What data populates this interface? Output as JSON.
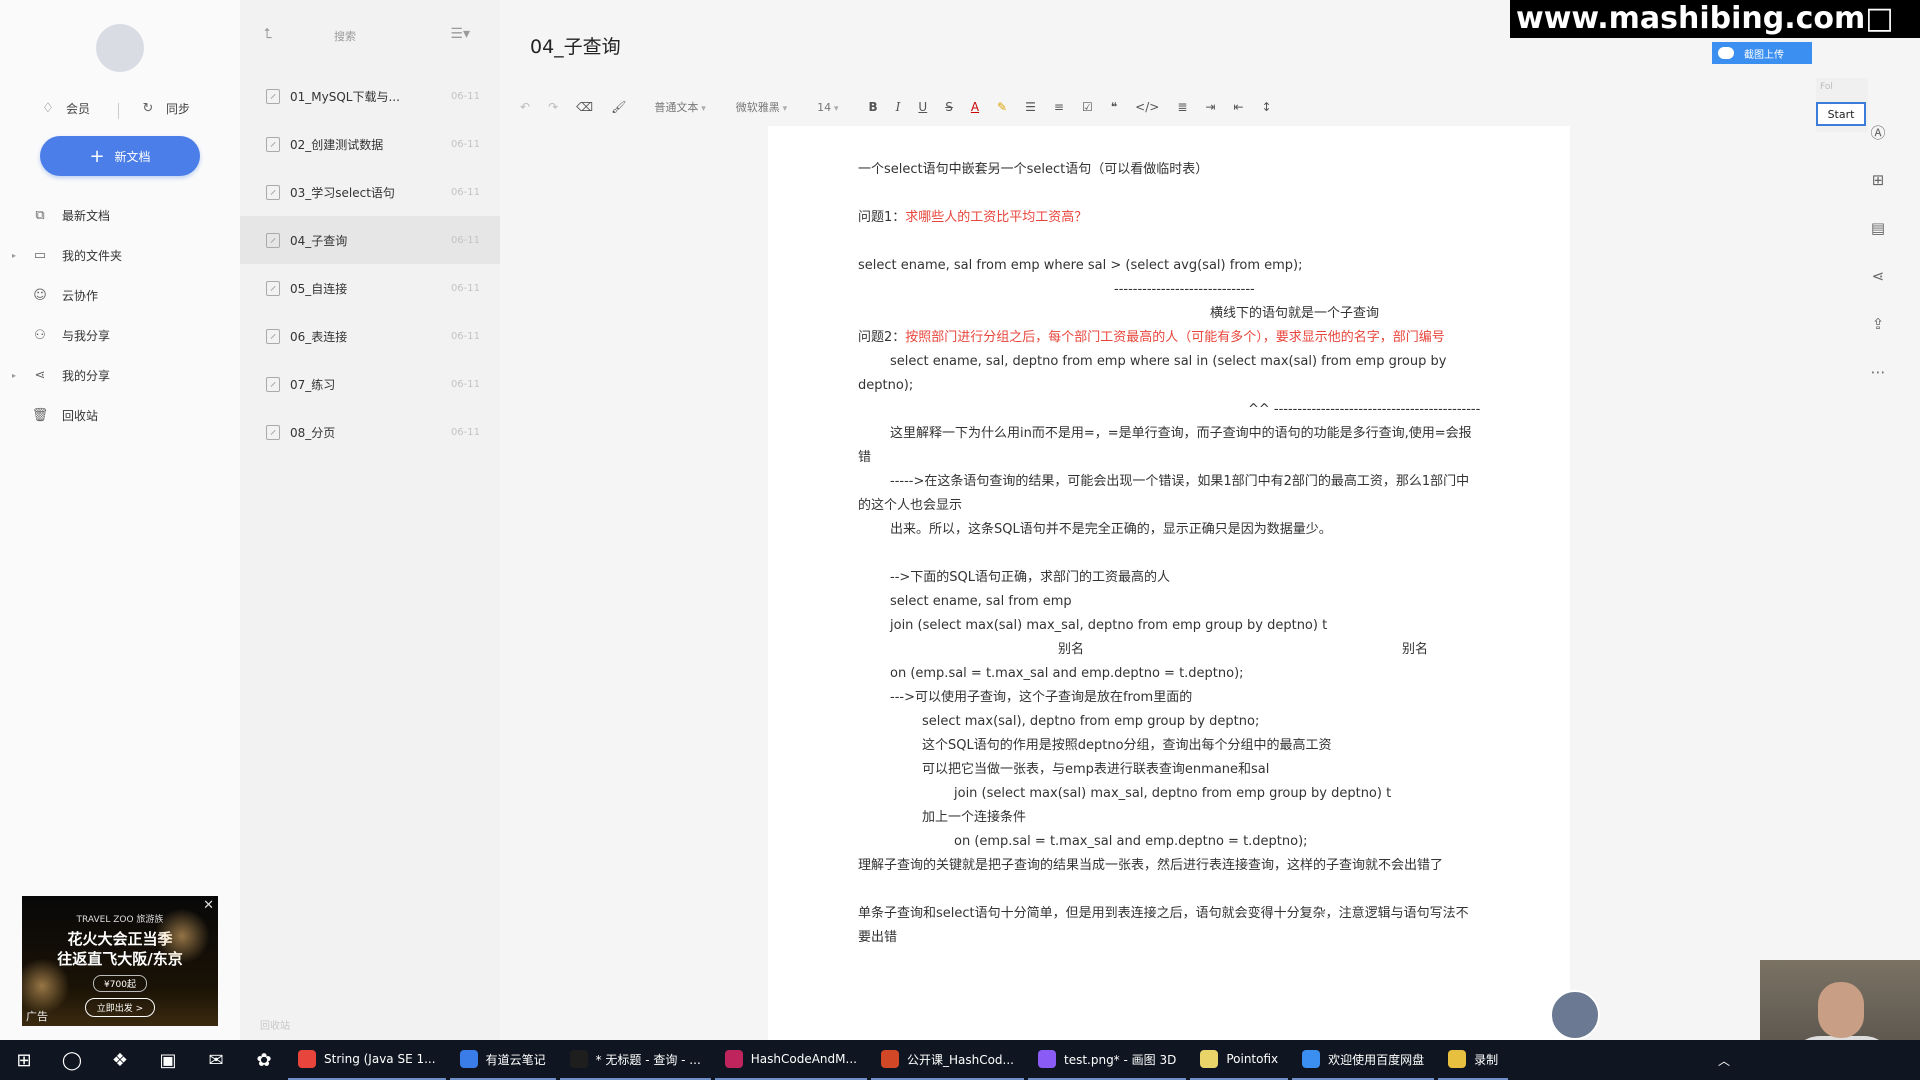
{
  "sidebar": {
    "top": {
      "member": "会员",
      "sync": "同步"
    },
    "new_doc": "新文档",
    "nav": [
      {
        "label": "最新文档",
        "icon": "layers-icon",
        "caret": false
      },
      {
        "label": "我的文件夹",
        "icon": "folder-icon",
        "caret": true
      },
      {
        "label": "云协作",
        "icon": "collab-icon",
        "caret": false
      },
      {
        "label": "与我分享",
        "icon": "shared-with-me-icon",
        "caret": false
      },
      {
        "label": "我的分享",
        "icon": "share-icon",
        "caret": true
      },
      {
        "label": "回收站",
        "icon": "trash-icon",
        "caret": false
      }
    ],
    "ad": {
      "brand": "TRAVEL ZOO 旅游族",
      "line1": "花火大会正当季",
      "line2": "往返直飞大阪/东京",
      "price": "¥700起",
      "cta": "立即出发 >",
      "tag": "广告"
    }
  },
  "doclist": {
    "search_placeholder": "搜索",
    "items": [
      {
        "title": "01_MySQL下载与...",
        "date": "06-11",
        "active": false
      },
      {
        "title": "02_创建测试数据",
        "date": "06-11",
        "active": false
      },
      {
        "title": "03_学习select语句",
        "date": "06-11",
        "active": false
      },
      {
        "title": "04_子查询",
        "date": "06-11",
        "active": true
      },
      {
        "title": "05_自连接",
        "date": "06-11",
        "active": false
      },
      {
        "title": "06_表连接",
        "date": "06-11",
        "active": false
      },
      {
        "title": "07_练习",
        "date": "06-11",
        "active": false
      },
      {
        "title": "08_分页",
        "date": "06-11",
        "active": false
      }
    ],
    "footer": "回收站"
  },
  "editor": {
    "title": "04_子查询",
    "toolbar": {
      "paragraph_style": "普通文本",
      "font_family": "微软雅黑",
      "font_size": "14"
    },
    "fps_label": "Fol",
    "start_label": "Start",
    "lines": [
      {
        "text": "一个select语句中嵌套另一个select语句（可以看做临时表）",
        "indent": 0
      },
      {
        "text": "",
        "indent": 0
      },
      {
        "text": "问题1：",
        "red": "求哪些人的工资比平均工资高？",
        "indent": 0
      },
      {
        "text": "",
        "indent": 0
      },
      {
        "text": "select ename, sal from emp where sal > (select avg(sal) from emp);",
        "indent": 0
      },
      {
        "text": "------------------------------",
        "indent": 256
      },
      {
        "text": "横线下的语句就是一个子查询",
        "indent": 352
      },
      {
        "text": "问题2：",
        "red": "按照部门进行分组之后，每个部门工资最高的人（可能有多个），要求显示他的名字，部门编号",
        "indent": 0,
        "wrap": true
      },
      {
        "text": "select ename, sal, deptno from emp where sal in (select max(sal) from emp group by deptno);",
        "indent": 0,
        "wrap": true,
        "first_indent": 32
      },
      {
        "text": "^^ --------------------------------------------",
        "indent": 390
      },
      {
        "text": "这里解释一下为什么用in而不是用=，=是单行查询，而子查询中的语句的功能是多行查询,使用=会报错",
        "indent": 0,
        "wrap": true,
        "first_indent": 32
      },
      {
        "text": "----->在这条语句查询的结果，可能会出现一个错误，如果1部门中有2部门的最高工资，那么1部门中的这个人也会显示",
        "indent": 0,
        "wrap": true,
        "first_indent": 32
      },
      {
        "text": "出来。所以，这条SQL语句并不是完全正确的，显示正确只是因为数据量少。",
        "indent": 32
      },
      {
        "text": "",
        "indent": 0
      },
      {
        "text": "-->下面的SQL语句正确，求部门的工资最高的人",
        "indent": 32
      },
      {
        "text": "select ename, sal from emp",
        "indent": 32
      },
      {
        "text": "join (select max(sal) max_sal, deptno from emp group by deptno) t",
        "indent": 32
      },
      {
        "text": "别名",
        "indent": 200,
        "text2": "别名",
        "indent2": 544
      },
      {
        "text": "on (emp.sal = t.max_sal and emp.deptno = t.deptno);",
        "indent": 32
      },
      {
        "text": "--->可以使用子查询，这个子查询是放在from里面的",
        "indent": 32
      },
      {
        "text": "select max(sal), deptno from emp group by deptno;",
        "indent": 64
      },
      {
        "text": "这个SQL语句的作用是按照deptno分组，查询出每个分组中的最高工资",
        "indent": 64
      },
      {
        "text": "可以把它当做一张表，与emp表进行联表查询enmane和sal",
        "indent": 64
      },
      {
        "text": "join (select max(sal) max_sal, deptno from emp group by deptno) t",
        "indent": 96
      },
      {
        "text": "加上一个连接条件",
        "indent": 64
      },
      {
        "text": "on (emp.sal = t.max_sal and emp.deptno = t.deptno);",
        "indent": 96
      },
      {
        "text": "理解子查询的关键就是把子查询的结果当成一张表，然后进行表连接查询，这样的子查询就不会出错了",
        "indent": 0,
        "wrap": true
      },
      {
        "text": "",
        "indent": 0
      },
      {
        "text": "单条子查询和select语句十分简单，但是用到表连接之后，语句就会变得十分复杂，注意逻辑与语句写法不要出错",
        "indent": 0,
        "wrap": true
      }
    ]
  },
  "overlay": {
    "watermark": "www.mashibing.com",
    "upload_label": "截图上传"
  },
  "taskbar": {
    "tasks": [
      {
        "label": "String (Java SE 1...",
        "color": "#e8453c"
      },
      {
        "label": "有道云笔记",
        "color": "#3b7de8"
      },
      {
        "label": "* 无标题 - 查询 - ...",
        "color": "#1e1e1e"
      },
      {
        "label": "HashCodeAndM...",
        "color": "#c0245c"
      },
      {
        "label": "公开课_HashCod...",
        "color": "#d24726"
      },
      {
        "label": "test.png* - 画图 3D",
        "color": "#8a5cf5"
      },
      {
        "label": "Pointofix",
        "color": "#e9d46a"
      },
      {
        "label": "欢迎使用百度网盘",
        "color": "#3b8ff0"
      },
      {
        "label": "录制",
        "color": "#e8c040"
      }
    ]
  },
  "colors": {
    "accent": "#4b7ee8",
    "red_text": "#e8463c",
    "taskbar": "#101621"
  }
}
